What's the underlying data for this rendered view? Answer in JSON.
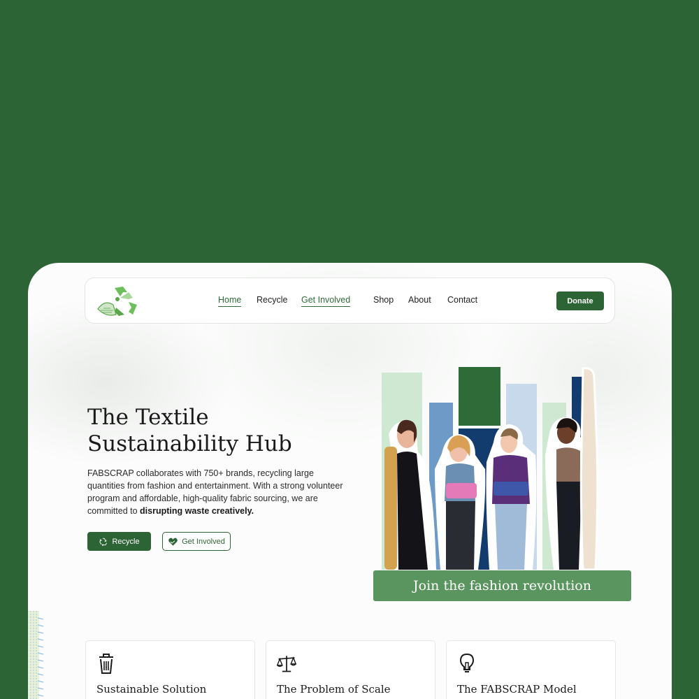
{
  "nav": {
    "links": [
      {
        "label": "Home",
        "active": true
      },
      {
        "label": "Recycle",
        "active": false
      },
      {
        "label": "Get Involved",
        "active": true
      },
      {
        "label": "Shop",
        "active": false
      },
      {
        "label": "About",
        "active": false
      },
      {
        "label": "Contact",
        "active": false
      }
    ],
    "donate_label": "Donate"
  },
  "hero": {
    "title_line1": "The Textile",
    "title_line2": "Sustainability Hub",
    "description": "FABSCRAP collaborates with 750+ brands, recycling large quantities from fashion and entertainment. With a strong volunteer program and affordable, high-quality fabric sourcing, we are committed to",
    "description_bold": "disrupting waste creatively.",
    "recycle_button": "Recycle",
    "get_involved_button": "Get Involved",
    "banner": "Join the fashion revolution"
  },
  "features": [
    {
      "icon": "trash-icon",
      "title": "Sustainable Solution"
    },
    {
      "icon": "scale-icon",
      "title": "The Problem of Scale"
    },
    {
      "icon": "lightbulb-icon",
      "title": "The FABSCRAP Model"
    }
  ],
  "colors": {
    "page_background": "#2d6436",
    "primary_green": "#2d6436",
    "banner_green": "#5a955f",
    "light_green": "#c9e4cc",
    "light_blue": "#c8d9ec",
    "mid_blue": "#6e9ac8",
    "navy": "#123c6e"
  }
}
